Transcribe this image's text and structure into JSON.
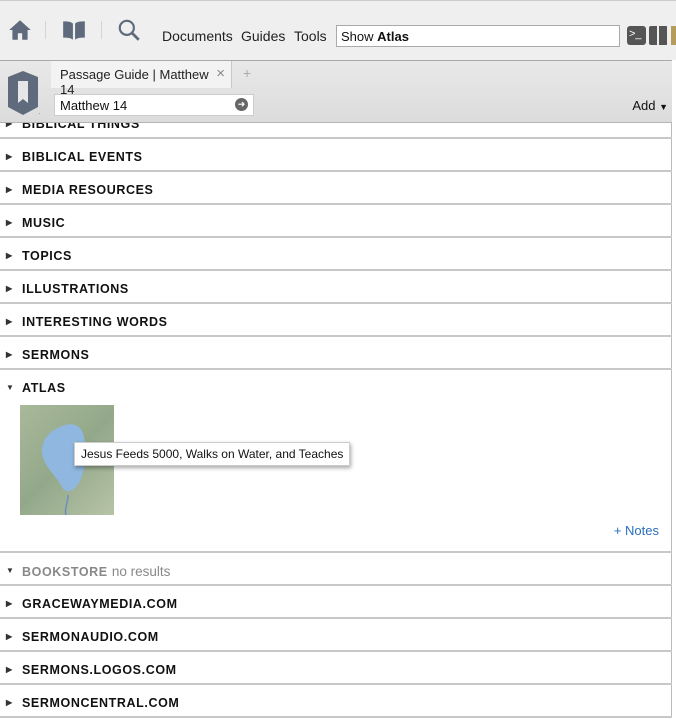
{
  "toolbar": {
    "menus": [
      "Documents",
      "Guides",
      "Tools"
    ],
    "command_prefix": "Show",
    "command_bold": "Atlas"
  },
  "tab": {
    "title": "Passage Guide | Matthew 14",
    "new_tab": "+"
  },
  "reference": {
    "value": "Matthew 14"
  },
  "add_label": "Add",
  "sections_top": [
    {
      "label": "BIBLICAL THINGS"
    },
    {
      "label": "BIBLICAL EVENTS"
    },
    {
      "label": "MEDIA RESOURCES"
    },
    {
      "label": "MUSIC"
    },
    {
      "label": "TOPICS"
    },
    {
      "label": "ILLUSTRATIONS"
    },
    {
      "label": "INTERESTING WORDS"
    },
    {
      "label": "SERMONS"
    }
  ],
  "atlas": {
    "label": "ATLAS",
    "map_tooltip": "Jesus Feeds 5000, Walks on Water, and Teaches",
    "notes_link": "+ Notes"
  },
  "bookstore": {
    "label": "BOOKSTORE",
    "status": "no results"
  },
  "sections_bottom": [
    {
      "label": "GRACEWAYMEDIA.COM"
    },
    {
      "label": "SERMONAUDIO.COM"
    },
    {
      "label": "SERMONS.LOGOS.COM"
    },
    {
      "label": "SERMONCENTRAL.COM"
    }
  ]
}
